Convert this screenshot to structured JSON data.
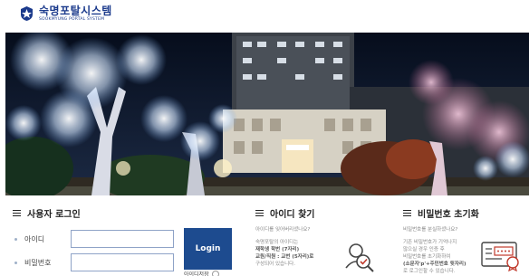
{
  "header": {
    "logo_name": "숙명포탈시스템",
    "logo_sub": "SOOKMYUNG PORTAL SYSTEM"
  },
  "login": {
    "title": "사용자 로그인",
    "id_label": "아이디",
    "pw_label": "비밀번호",
    "id_value": "",
    "pw_value": "",
    "button": "Login",
    "save_id": "아이디저장"
  },
  "find_id": {
    "title": "아이디 찾기",
    "subtitle": "아이디를 잊어버리셨나요?",
    "desc_1": "숙명포탈의 아이디는",
    "desc_2": "재학생 학번 (7자리)",
    "desc_3": "교원/직원 : 교번 (5자리)로",
    "desc_4": "구성되어 있습니다."
  },
  "reset_pw": {
    "title": "비밀번호 초기화",
    "subtitle": "비밀번호를 분실하셨나요?",
    "desc_1": "기존 비밀번호가 기억나지",
    "desc_2": "않으실 경우 인증 후",
    "desc_3": "비밀번호를 초기화하여",
    "desc_4": "(소문자'p'+주민번호 뒷자리)",
    "desc_5": "로 로그인할 수 있습니다."
  },
  "colors": {
    "brand": "#1b3a8c",
    "login_button": "#1d4b8f",
    "input_border": "#8fa3c7"
  }
}
